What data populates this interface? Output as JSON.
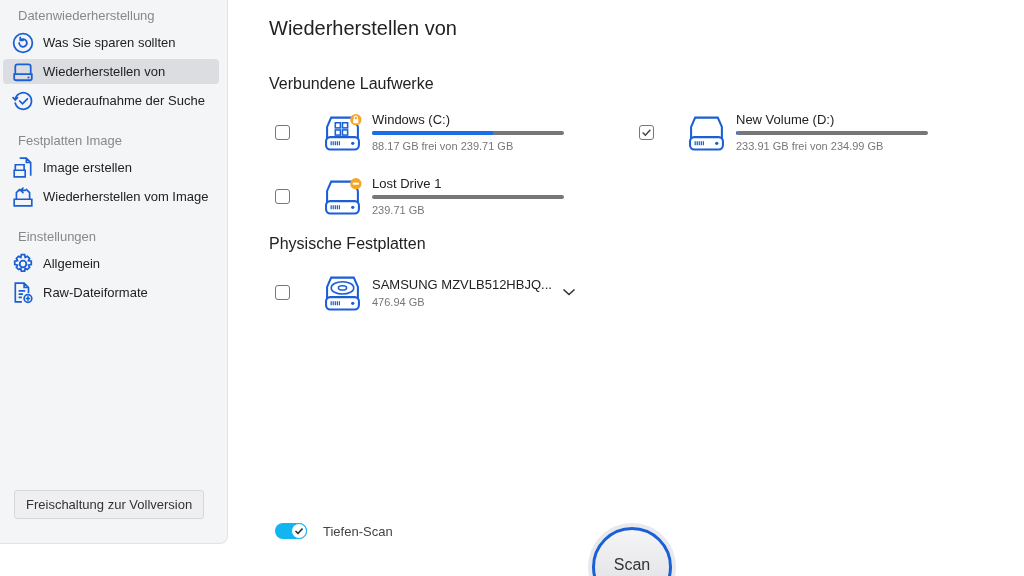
{
  "sidebar": {
    "groups": [
      {
        "title": "Datenwiederherstellung",
        "items": [
          {
            "label": "Was Sie sparen sollten",
            "kind": "restore",
            "selected": false
          },
          {
            "label": "Wiederherstellen von",
            "kind": "drive",
            "selected": true
          },
          {
            "label": "Wiederaufnahme der Suche",
            "kind": "resume",
            "selected": false
          }
        ]
      },
      {
        "title": "Festplatten Image",
        "items": [
          {
            "label": "Image erstellen",
            "kind": "image-create",
            "selected": false
          },
          {
            "label": "Wiederherstellen vom Image",
            "kind": "image-restore",
            "selected": false
          }
        ]
      },
      {
        "title": "Einstellungen",
        "items": [
          {
            "label": "Allgemein",
            "kind": "gear",
            "selected": false
          },
          {
            "label": "Raw-Dateiformate",
            "kind": "file-add",
            "selected": false
          }
        ]
      }
    ],
    "upgrade_button": "Freischaltung zur Vollversion"
  },
  "title": "Wiederherstellen von",
  "sections": [
    {
      "title": "Verbundene Laufwerke",
      "drives": [
        {
          "name": "Windows (C:)",
          "detail": "88.17 GB frei von 239.71 GB",
          "kind": "windows-locked",
          "checked": false,
          "level": 0.63
        },
        {
          "name": "New Volume (D:)",
          "detail": "233.91 GB frei von 234.99 GB",
          "kind": "volume",
          "checked": true,
          "level": 0.005
        },
        {
          "name": "Lost Drive 1",
          "detail": "239.71 GB",
          "kind": "volume-lost",
          "checked": false,
          "level": 0
        }
      ]
    },
    {
      "title": "Physische Festplatten",
      "drives": [
        {
          "name": "SAMSUNG MZVLB512HBJQ...",
          "detail": "476.94 GB",
          "kind": "disk",
          "checked": false,
          "expandable": true
        }
      ]
    }
  ],
  "deep_scan": {
    "label": "Tiefen-Scan",
    "on": true
  },
  "scan_button": "Scan"
}
